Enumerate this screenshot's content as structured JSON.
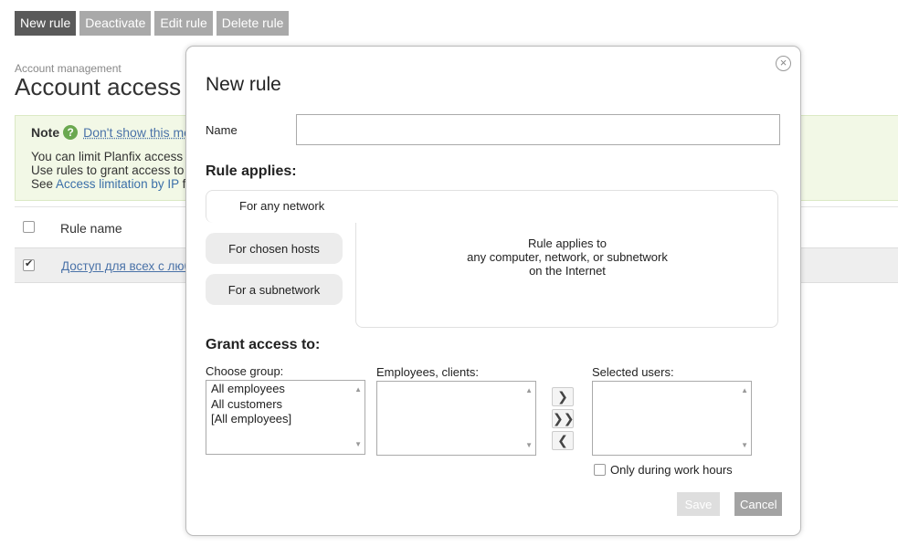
{
  "toolbar": {
    "new_rule": "New rule",
    "deactivate": "Deactivate",
    "edit_rule": "Edit rule",
    "delete_rule": "Delete rule"
  },
  "page": {
    "breadcrumb": "Account management",
    "title": "Account access"
  },
  "note": {
    "label": "Note",
    "dismiss_link": "Don't show this mes",
    "line1": "You can limit Planfix access l",
    "line2": "Use rules to grant access to",
    "line3_prefix": "See",
    "line3_link": "Access limitation by IP",
    "line3_suffix": "fo"
  },
  "table": {
    "header": "Rule name",
    "rows": [
      {
        "name": "Доступ для всех с люб",
        "checked": true
      }
    ]
  },
  "dialog": {
    "title": "New rule",
    "name_label": "Name",
    "name_value": "",
    "rule_applies_title": "Rule applies:",
    "tabs": {
      "any_network": "For any network",
      "chosen_hosts": "For chosen hosts",
      "subnetwork": "For a subnetwork"
    },
    "tab_description": {
      "line1": "Rule applies to",
      "line2": "any computer, network, or subnetwork",
      "line3": "on the Internet"
    },
    "grant_access_title": "Grant access to:",
    "choose_group_label": "Choose group:",
    "groups": [
      "All employees",
      "All customers",
      "[All employees]"
    ],
    "employees_label": "Employees, clients:",
    "selected_users_label": "Selected users:",
    "arrows": {
      "add": "❯",
      "add_all": "❯❯",
      "remove": "❮"
    },
    "work_hours_label": "Only during work hours",
    "save": "Save",
    "cancel": "Cancel"
  }
}
